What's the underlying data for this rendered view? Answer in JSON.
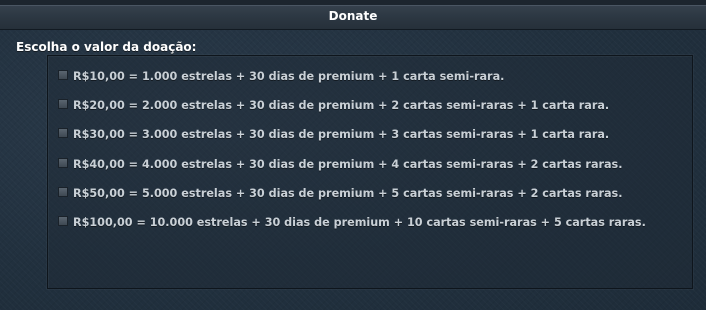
{
  "header": {
    "title": "Donate"
  },
  "form": {
    "prompt": "Escolha o valor da doação:",
    "options": [
      {
        "label": "R$10,00 = 1.000 estrelas + 30 dias de premium + 1 carta semi-rara.",
        "checked": false
      },
      {
        "label": "R$20,00 = 2.000 estrelas + 30 dias de premium + 2 cartas semi-raras + 1 carta rara.",
        "checked": false
      },
      {
        "label": "R$30,00 = 3.000 estrelas + 30 dias de premium + 3 cartas semi-raras + 1 carta rara.",
        "checked": false
      },
      {
        "label": "R$40,00 = 4.000 estrelas + 30 dias de premium + 4 cartas semi-raras + 2 cartas raras.",
        "checked": false
      },
      {
        "label": "R$50,00 = 5.000 estrelas + 30 dias de premium + 5 cartas semi-raras + 2 cartas raras.",
        "checked": false
      },
      {
        "label": "R$100,00 = 10.000 estrelas + 30 dias de premium + 10 cartas semi-raras + 5 cartas raras.",
        "checked": false
      }
    ]
  }
}
